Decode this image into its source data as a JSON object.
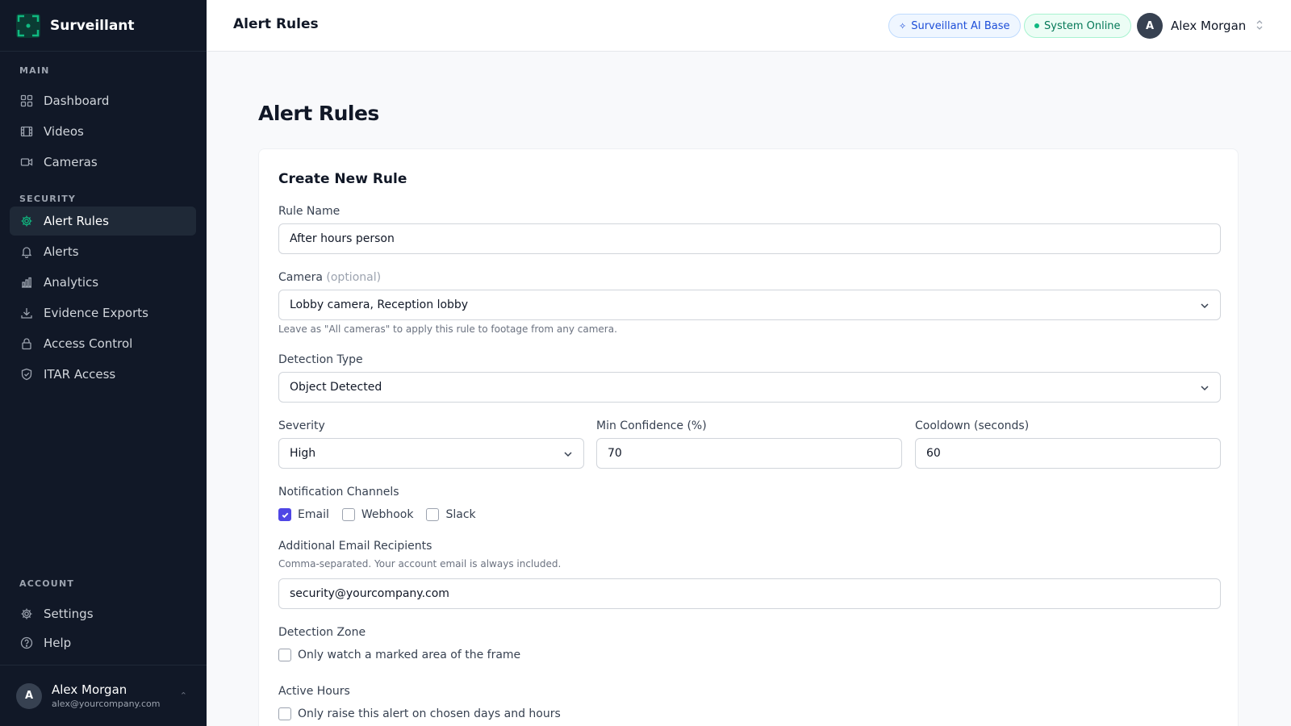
{
  "app": {
    "name": "Surveillant",
    "brand_color": "#10b981"
  },
  "sidebar": {
    "sections": {
      "main": "MAIN",
      "security": "SECURITY",
      "account": "ACCOUNT"
    },
    "items": [
      {
        "label": "Dashboard",
        "icon": "grid-icon"
      },
      {
        "label": "Videos",
        "icon": "film-icon"
      },
      {
        "label": "Cameras",
        "icon": "video-camera-icon"
      },
      {
        "label": "Alert Rules",
        "icon": "gear-icon",
        "active": true
      },
      {
        "label": "Alerts",
        "icon": "bell-icon"
      },
      {
        "label": "Analytics",
        "icon": "bar-chart-icon"
      },
      {
        "label": "Evidence Exports",
        "icon": "download-icon"
      },
      {
        "label": "Access Control",
        "icon": "lock-icon"
      },
      {
        "label": "ITAR Access",
        "icon": "shield-check-icon"
      },
      {
        "label": "Settings",
        "icon": "gear-icon"
      },
      {
        "label": "Help",
        "icon": "help-circle-icon"
      }
    ],
    "user": {
      "initial": "A",
      "name": "Alex Morgan",
      "email": "alex@yourcompany.com"
    }
  },
  "topbar": {
    "title": "Alert Rules",
    "ai_badge": "Surveillant AI Base",
    "status_badge": "System Online",
    "user_initial": "A",
    "user_name": "Alex Morgan"
  },
  "page": {
    "title": "Alert Rules"
  },
  "form": {
    "card_title": "Create New Rule",
    "rule_name": {
      "label": "Rule Name",
      "value": "After hours person"
    },
    "camera": {
      "label": "Camera",
      "optional": "(optional)",
      "value": "Lobby camera, Reception lobby",
      "help": "Leave as \"All cameras\" to apply this rule to footage from any camera."
    },
    "detection_type": {
      "label": "Detection Type",
      "value": "Object Detected"
    },
    "severity": {
      "label": "Severity",
      "value": "High"
    },
    "min_confidence": {
      "label": "Min Confidence (%)",
      "value": "70"
    },
    "cooldown": {
      "label": "Cooldown (seconds)",
      "value": "60"
    },
    "notification_channels": {
      "label": "Notification Channels",
      "options": [
        {
          "label": "Email",
          "checked": true
        },
        {
          "label": "Webhook",
          "checked": false
        },
        {
          "label": "Slack",
          "checked": false
        }
      ]
    },
    "email_recipients": {
      "label": "Additional Email Recipients",
      "help": "Comma-separated. Your account email is always included.",
      "value": "security@yourcompany.com"
    },
    "detection_zone": {
      "label": "Detection Zone",
      "option": "Only watch a marked area of the frame",
      "checked": false
    },
    "active_hours": {
      "label": "Active Hours",
      "option": "Only raise this alert on chosen days and hours",
      "checked": false
    }
  }
}
